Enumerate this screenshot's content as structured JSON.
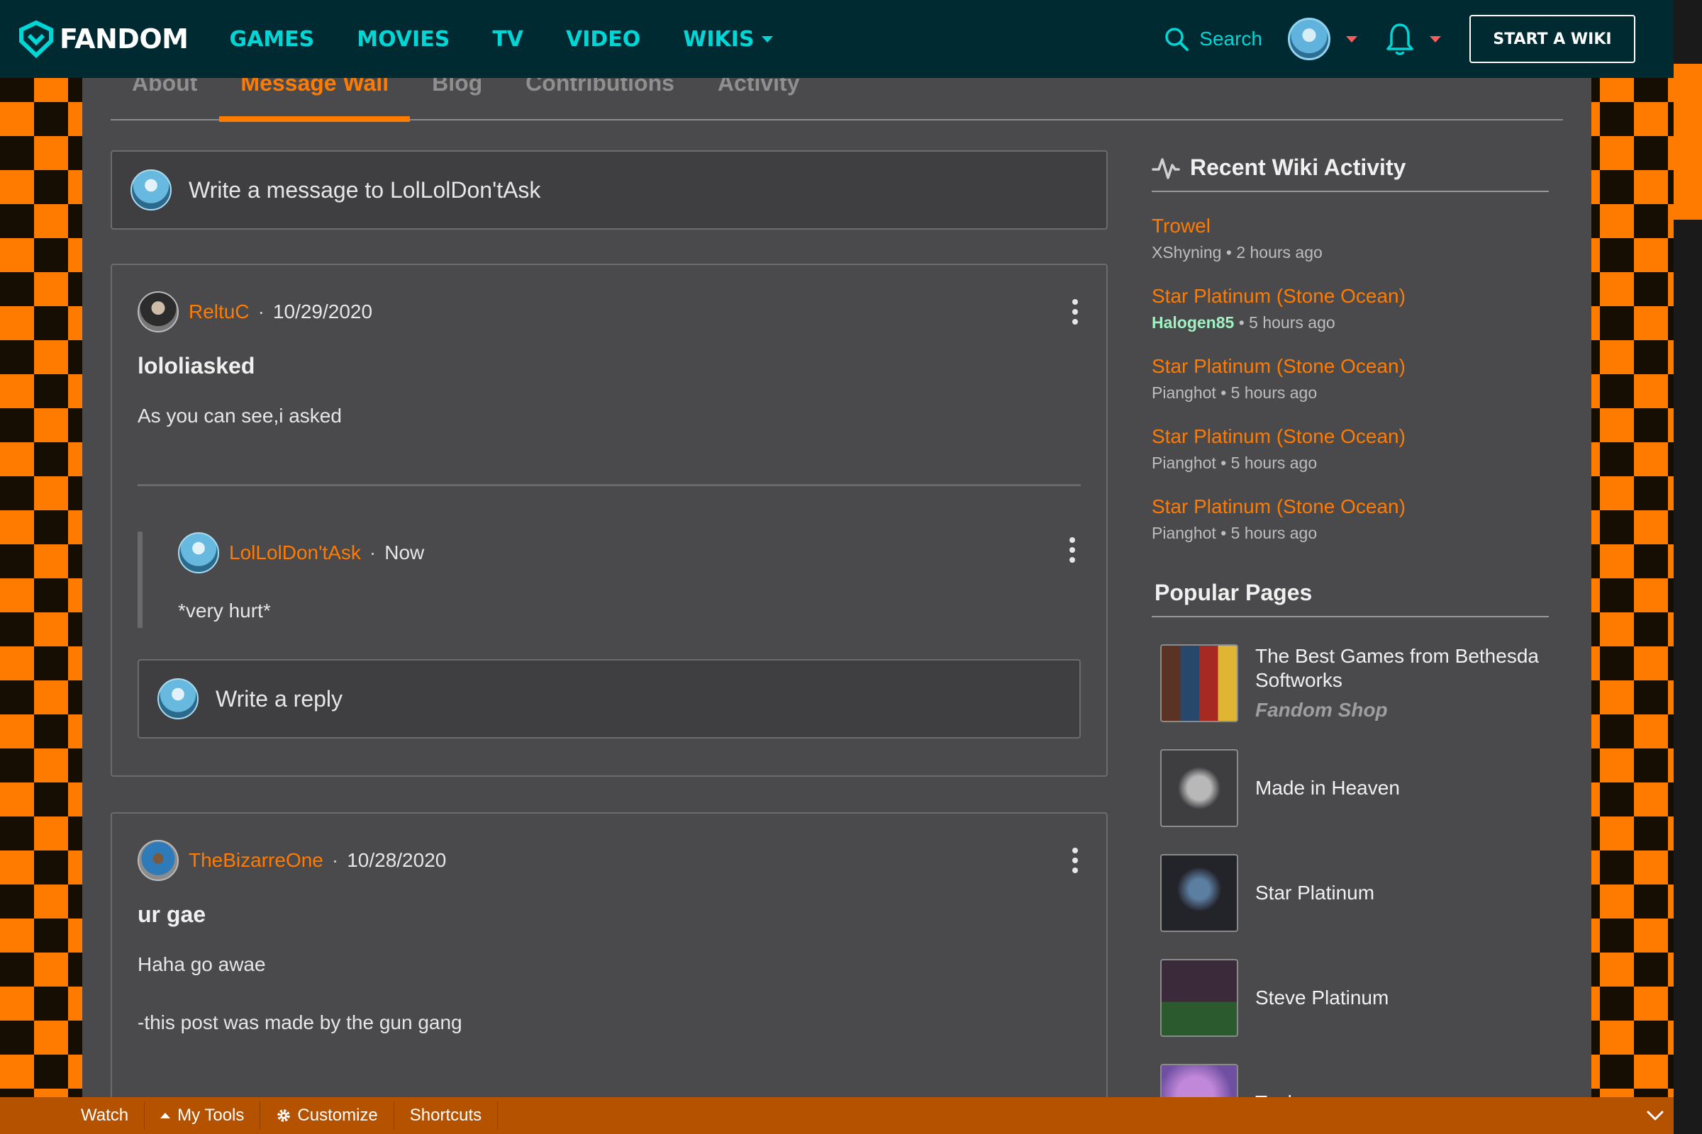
{
  "nav": {
    "logo_text": "FANDOM",
    "links": [
      "GAMES",
      "MOVIES",
      "TV",
      "VIDEO",
      "WIKIS"
    ],
    "search_label": "Search",
    "start_wiki_label": "START A WIKI",
    "colors": {
      "bar": "#002a32",
      "accent": "#00d6d6"
    }
  },
  "tabs": {
    "items": [
      "About",
      "Message Wall",
      "Blog",
      "Contributions",
      "Activity"
    ],
    "active": "Message Wall"
  },
  "compose": {
    "placeholder": "Write a message to LolLolDon'tAsk"
  },
  "posts": [
    {
      "author": "ReltuC",
      "date": "10/29/2020",
      "title": "lololiasked",
      "body": "As you can see,i asked",
      "reply": {
        "author": "LolLolDon'tAsk",
        "date": "Now",
        "body": "*very hurt*"
      },
      "reply_placeholder": "Write a reply"
    },
    {
      "author": "TheBizarreOne",
      "date": "10/28/2020",
      "title": "ur gae",
      "body": "Haha go awae",
      "body2": "-this post was made by the gun gang"
    }
  ],
  "sidebar": {
    "recent_title": "Recent Wiki Activity",
    "activity": [
      {
        "page": "Trowel",
        "user": "XShyning",
        "time": "2 hours ago"
      },
      {
        "page": "Star Platinum (Stone Ocean)",
        "user": "Halogen85",
        "time": "5 hours ago"
      },
      {
        "page": "Star Platinum (Stone Ocean)",
        "user": "Pianghot",
        "time": "5 hours ago"
      },
      {
        "page": "Star Platinum (Stone Ocean)",
        "user": "Pianghot",
        "time": "5 hours ago"
      },
      {
        "page": "Star Platinum (Stone Ocean)",
        "user": "Pianghot",
        "time": "5 hours ago"
      }
    ],
    "popular_title": "Popular Pages",
    "popular": [
      {
        "title": "The Best Games from Bethesda Softworks",
        "sub": "Fandom Shop"
      },
      {
        "title": "Made in Heaven"
      },
      {
        "title": "Star Platinum"
      },
      {
        "title": "Steve Platinum"
      },
      {
        "title": "Tusk"
      }
    ]
  },
  "separator": "•",
  "toolbar": {
    "items": [
      "Watch",
      "My Tools",
      "Customize",
      "Shortcuts"
    ],
    "color": "#b55200"
  },
  "icons": [
    "fandom-logo-icon",
    "chevron-down-icon",
    "search-icon",
    "bell-icon",
    "kebab-icon",
    "activity-icon",
    "gear-icon",
    "caret-up-icon"
  ]
}
